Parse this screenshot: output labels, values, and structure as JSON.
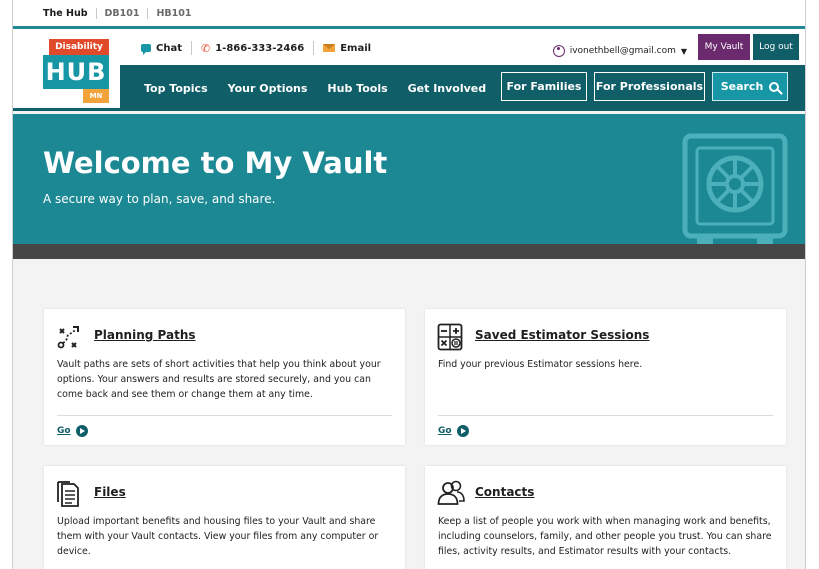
{
  "site_tabs": [
    "The Hub",
    "DB101",
    "HB101"
  ],
  "logo": {
    "top": "Disability",
    "main": "HUB",
    "bottom": "MN"
  },
  "contact": {
    "chat": "Chat",
    "phone": "1-866-333-2466",
    "email": "Email"
  },
  "user": {
    "email": "ivonethbell@gmail.com",
    "my_vault": "My Vault",
    "logout": "Log out"
  },
  "nav": {
    "links": [
      "Top Topics",
      "Your Options",
      "Hub Tools",
      "Get Involved"
    ],
    "families": "For Families",
    "professionals": "For Professionals",
    "search": "Search"
  },
  "hero": {
    "title": "Welcome to My Vault",
    "subtitle": "A secure way to plan, save, and share."
  },
  "cards": [
    {
      "title": "Planning Paths",
      "description": "Vault paths are sets of short activities that help you think about your options. Your answers and results are stored securely, and you can come back and see them or change them at any time.",
      "go": "Go",
      "icon": "planning-paths-icon"
    },
    {
      "title": "Saved Estimator Sessions",
      "description": "Find your previous Estimator sessions here.",
      "go": "Go",
      "icon": "calculator-icon"
    },
    {
      "title": "Files",
      "description": "Upload important benefits and housing files to your Vault and share them with your Vault contacts. View your files from any computer or device.",
      "icon": "files-icon"
    },
    {
      "title": "Contacts",
      "description": "Keep a list of people you work with when managing work and benefits, including counselors, family, and other people you trust. You can share files, activity results, and Estimator results with your contacts.",
      "icon": "contacts-icon"
    }
  ],
  "colors": {
    "teal": "#1b8893",
    "dark_teal": "#0f5e68",
    "purple": "#6b2a6e",
    "orange": "#e04a2b",
    "yellow": "#f2a33b"
  }
}
